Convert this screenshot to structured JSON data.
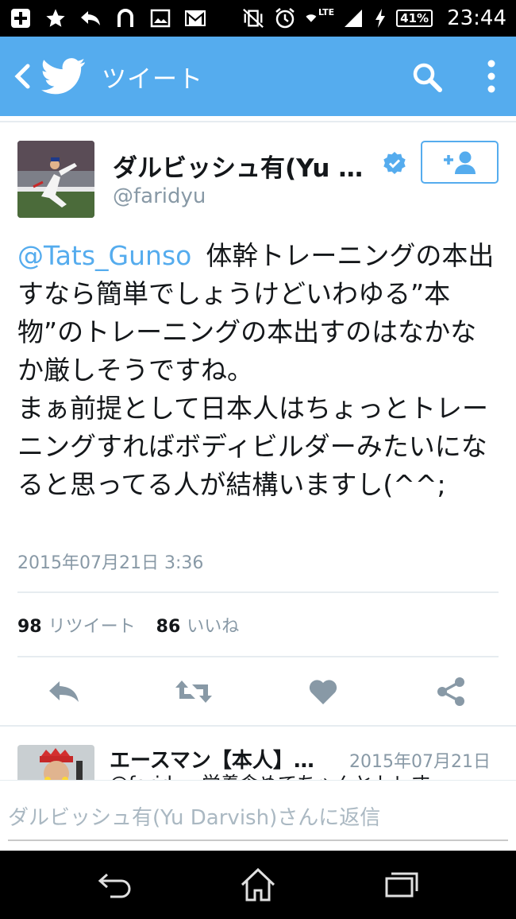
{
  "status_bar": {
    "time": "23:44",
    "battery": "41%",
    "network": "LTE",
    "icons": [
      "add-box-icon",
      "star-icon",
      "reply-icon",
      "headset-icon",
      "image-icon",
      "gmail-icon",
      "vibrate-off-icon",
      "alarm-icon",
      "wifi-icon",
      "signal-icon",
      "charging-icon",
      "battery-icon"
    ]
  },
  "app_bar": {
    "title": "ツイート",
    "color": "#55acee"
  },
  "tweet": {
    "author_name": "ダルビッシュ有(Yu D…",
    "handle": "@faridyu",
    "verified": true,
    "mention": "@Tats_Gunso",
    "body": "体幹トレーニングの本出すなら簡単でしょうけどいわゆる”本物”のトレーニングの本出すのはなかなか厳しそうですね。\nまぁ前提として日本人はちょっとトレーニングすればボディビルダーみたいになると思ってる人が結構いますし(^^;",
    "timestamp": "2015年07月21日 3:36"
  },
  "stats": {
    "retweets_count": "98",
    "retweets_label": "リツイート",
    "likes_count": "86",
    "likes_label": "いいね"
  },
  "actions": [
    "reply-icon",
    "retweet-icon",
    "like-icon",
    "share-icon"
  ],
  "reply_preview": {
    "name": "エースマン【本人】…",
    "date": "2015年07月21日",
    "snippet": "@faridyu 栄養含めてちゃんとトレす…"
  },
  "composer": {
    "placeholder": "ダルビッシュ有(Yu Darvish)さんに返信"
  },
  "nav_bar": {
    "buttons": [
      "back-icon",
      "home-icon",
      "recents-icon"
    ]
  }
}
